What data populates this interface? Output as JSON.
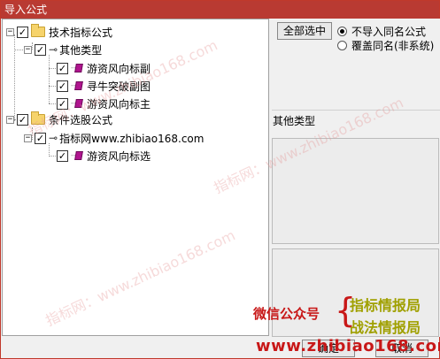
{
  "window": {
    "title": "导入公式"
  },
  "tree": {
    "nodes": [
      {
        "label": "技术指标公式"
      },
      {
        "label": "其他类型"
      },
      {
        "label": "游资风向标副"
      },
      {
        "label": "寻牛突破副图"
      },
      {
        "label": "游资风向标主"
      },
      {
        "label": "条件选股公式"
      },
      {
        "label": "指标网www.zhibiao168.com"
      },
      {
        "label": "游资风向标选"
      }
    ],
    "expand_glyph": "−",
    "check_glyph": "✓"
  },
  "options": {
    "select_all": "全部选中",
    "radio_no_import": "不导入同名公式",
    "radio_overwrite": "覆盖同名(非系统)"
  },
  "details": {
    "type_label": "其他类型"
  },
  "buttons": {
    "ok": "确定",
    "cancel": "取消"
  },
  "overlay": {
    "watermark": "指标网：www.zhibiao168.com",
    "wechat": "微信公众号",
    "brace": "{",
    "line1": "指标情报局",
    "line2": "战法情报局",
    "url": "www.zhibiao168.com"
  }
}
